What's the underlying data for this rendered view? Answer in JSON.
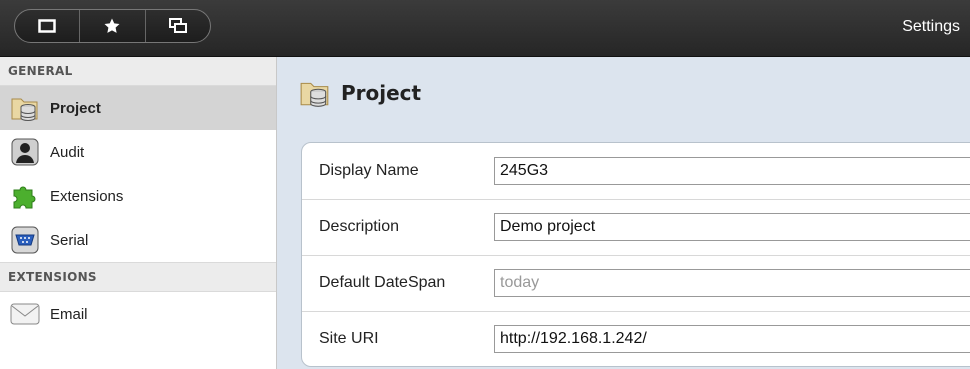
{
  "topbar": {
    "title": "Settings",
    "buttons": [
      {
        "icon": "square-icon"
      },
      {
        "icon": "star-icon"
      },
      {
        "icon": "windows-icon"
      }
    ]
  },
  "sidebar": {
    "sections": [
      {
        "header": "GENERAL",
        "items": [
          {
            "label": "Project",
            "icon": "project-db-icon",
            "selected": true
          },
          {
            "label": "Audit",
            "icon": "user-icon",
            "selected": false
          },
          {
            "label": "Extensions",
            "icon": "puzzle-icon",
            "selected": false
          },
          {
            "label": "Serial",
            "icon": "serial-port-icon",
            "selected": false
          }
        ]
      },
      {
        "header": "EXTENSIONS",
        "items": [
          {
            "label": "Email",
            "icon": "envelope-icon",
            "selected": false
          }
        ]
      }
    ]
  },
  "main": {
    "title": "Project",
    "fields": [
      {
        "label": "Display Name",
        "value": "245G3",
        "placeholder": ""
      },
      {
        "label": "Description",
        "value": "Demo project",
        "placeholder": ""
      },
      {
        "label": "Default DateSpan",
        "value": "",
        "placeholder": "today"
      },
      {
        "label": "Site URI",
        "value": "http://192.168.1.242/",
        "placeholder": ""
      }
    ]
  },
  "colors": {
    "topbar": "#2b2b2b",
    "main_bg": "#dce4ee",
    "selected_item": "#d4d4d4",
    "section_header": "#ececec"
  }
}
